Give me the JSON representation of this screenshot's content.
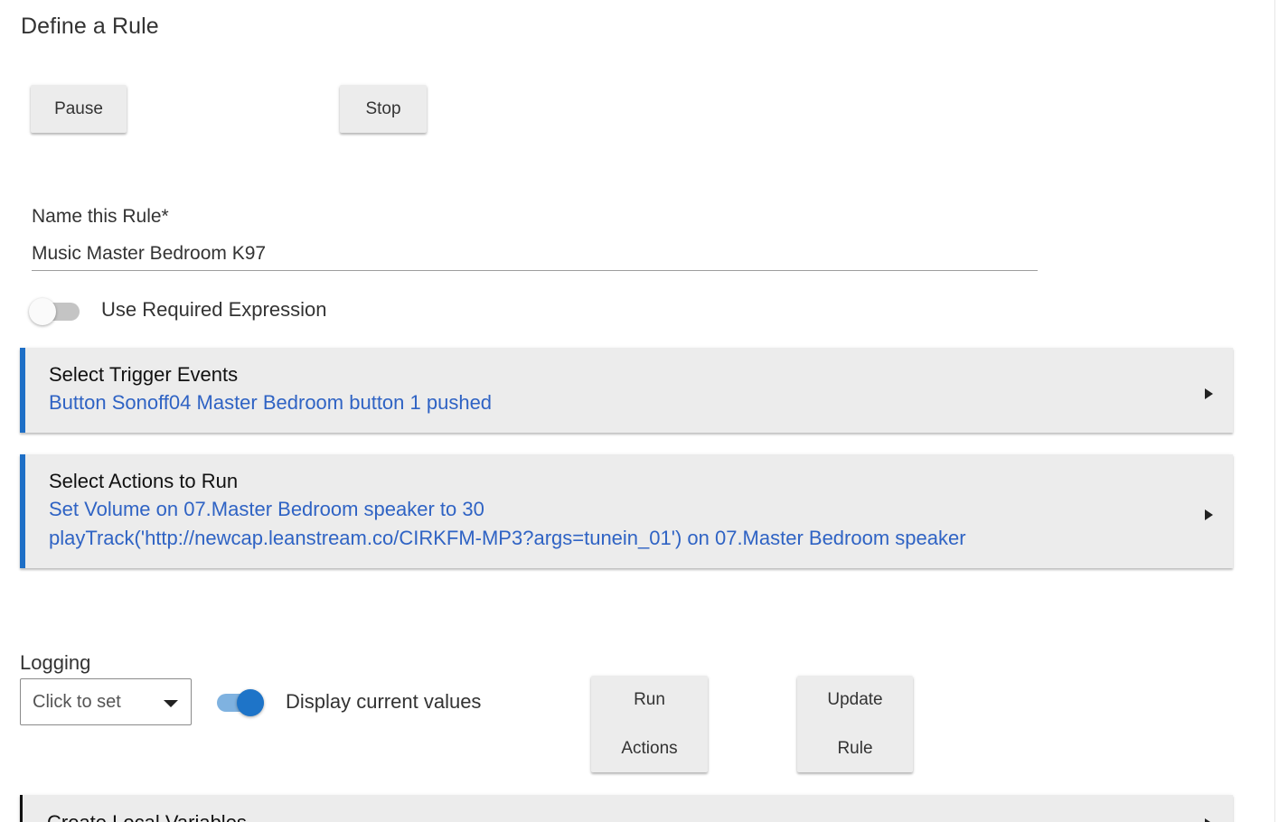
{
  "page": {
    "title": "Define a Rule"
  },
  "controls": {
    "pause_label": "Pause",
    "stop_label": "Stop"
  },
  "rule_name": {
    "label": "Name this Rule*",
    "value": "Music Master Bedroom K97"
  },
  "required_expression": {
    "label": "Use Required Expression",
    "enabled": false
  },
  "sections": {
    "trigger": {
      "title": "Select Trigger Events",
      "lines": [
        "Button Sonoff04 Master Bedroom button 1 pushed"
      ],
      "icon": "caret-right-icon"
    },
    "actions": {
      "title": "Select Actions to Run",
      "lines": [
        "Set Volume on 07.Master Bedroom speaker to 30",
        "playTrack('http://newcap.leanstream.co/CIRKFM-MP3?args=tunein_01') on 07.Master Bedroom speaker"
      ],
      "icon": "caret-right-icon"
    },
    "local_variables": {
      "title": "Create Local Variables",
      "icon": "caret-right-icon"
    }
  },
  "logging": {
    "label": "Logging",
    "select_value": "Click to set",
    "display_values_label": "Display current values",
    "display_values_enabled": true
  },
  "actions_bar": {
    "run_label": "Run\nActions",
    "update_label": "Update\nRule"
  },
  "colors": {
    "accent": "#1e6fc6",
    "link_text": "#2f63c4",
    "panel_bg": "#ececec"
  }
}
